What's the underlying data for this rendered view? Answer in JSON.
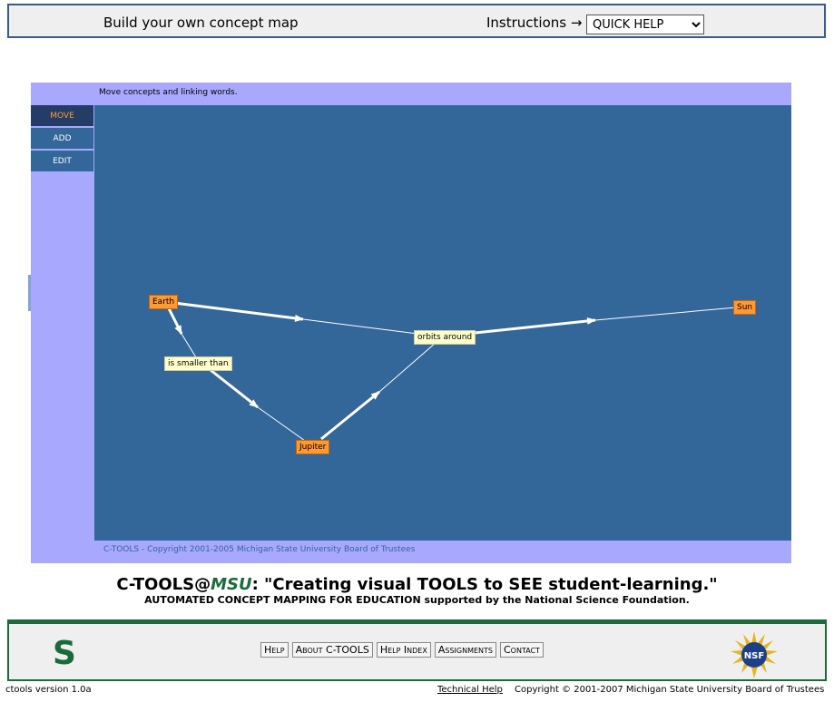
{
  "header": {
    "title": "Build your own concept map",
    "instructions_label": "Instructions →",
    "quick_help_selected": "QUICK HELP"
  },
  "applet": {
    "status": "Move concepts and linking words.",
    "modes": [
      "MOVE",
      "ADD",
      "EDIT"
    ],
    "active_mode": "MOVE",
    "concepts": {
      "earth": "Earth",
      "sun": "Sun",
      "jupiter": "Jupiter"
    },
    "linking_words": {
      "smaller": "is smaller than",
      "orbits": "orbits around"
    },
    "copyright": "C-TOOLS - Copyright 2001-2005 Michigan State University Board of Trustees"
  },
  "tagline": {
    "prefix": "C-TOOLS@",
    "msu": "MSU",
    "rest": ": \"Creating visual TOOLS to SEE student-learning.\"",
    "subline": "AUTOMATED CONCEPT MAPPING FOR EDUCATION supported by the National Science Foundation."
  },
  "footer": {
    "msu_logo": "S",
    "nav": [
      "Help",
      "About C-TOOLS",
      "Help Index",
      "Assignments",
      "Contact"
    ],
    "nsf_logo": "NSF",
    "version": "ctools version 1.0a",
    "technical_help": "Technical Help",
    "copyright": "Copyright © 2001-2007 Michigan State University Board of Trustees"
  },
  "colors": {
    "canvas": "#336699",
    "applet_bg": "#a8a8ff",
    "concept": "#ff9933",
    "linking_word": "#ffffcc",
    "msu_green": "#1a6b3a"
  }
}
